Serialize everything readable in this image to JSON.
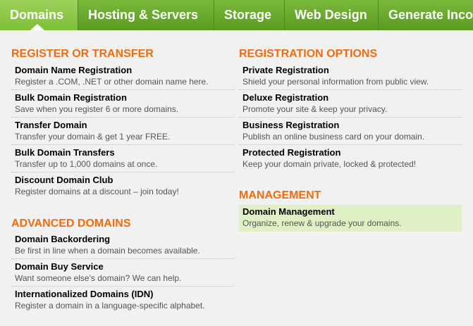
{
  "nav": {
    "tabs": [
      {
        "label": "Domains"
      },
      {
        "label": "Hosting & Servers"
      },
      {
        "label": "Storage"
      },
      {
        "label": "Web Design"
      },
      {
        "label": "Generate Inco"
      }
    ]
  },
  "left": {
    "register": {
      "title": "REGISTER OR TRANSFER",
      "items": [
        {
          "title": "Domain Name Registration",
          "desc": "Register a .COM, .NET or other domain name here."
        },
        {
          "title": "Bulk Domain Registration",
          "desc": "Save when you register 6 or more domains."
        },
        {
          "title": "Transfer Domain",
          "desc": "Transfer your domain & get 1 year FREE."
        },
        {
          "title": "Bulk Domain Transfers",
          "desc": "Transfer up to 1,000 domains at once."
        },
        {
          "title": "Discount Domain Club",
          "desc": "Register domains at a discount – join today!"
        }
      ]
    },
    "advanced": {
      "title": "ADVANCED DOMAINS",
      "items": [
        {
          "title": "Domain Backordering",
          "desc": "Be first in line when a domain becomes available."
        },
        {
          "title": "Domain Buy Service",
          "desc": "Want someone else's domain? We can help."
        },
        {
          "title": "Internationalized Domains (IDN)",
          "desc": "Register a domain in a language-specific alphabet."
        }
      ]
    }
  },
  "right": {
    "options": {
      "title": "REGISTRATION OPTIONS",
      "items": [
        {
          "title": "Private Registration",
          "desc": "Shield your personal information from public view."
        },
        {
          "title": "Deluxe Registration",
          "desc": "Promote your site & keep your privacy."
        },
        {
          "title": "Business Registration",
          "desc": "Publish an online business card on your domain."
        },
        {
          "title": "Protected Registration",
          "desc": "Keep your domain private, locked & protected!"
        }
      ]
    },
    "management": {
      "title": "MANAGEMENT",
      "items": [
        {
          "title": "Domain Management",
          "desc": "Organize, renew & upgrade your domains."
        }
      ]
    }
  },
  "colors": {
    "accent": "#f26b0d",
    "nav_green": "#6aab2e",
    "highlight": "#dff0c5"
  }
}
